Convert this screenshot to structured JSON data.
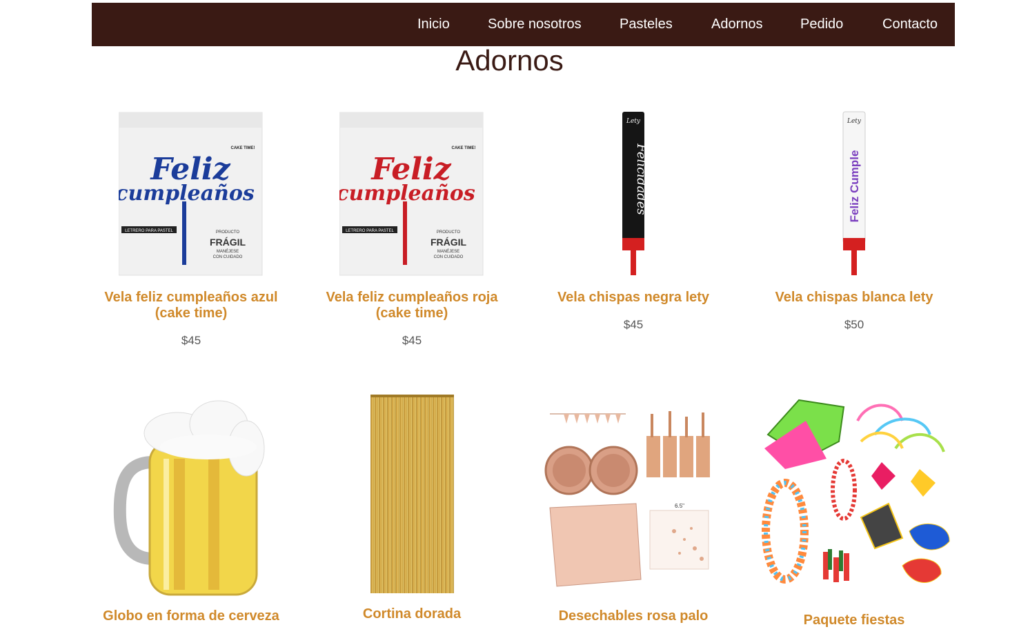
{
  "nav": {
    "items": [
      "Inicio",
      "Sobre nosotros",
      "Pasteles",
      "Adornos",
      "Pedido",
      "Contacto"
    ]
  },
  "page": {
    "title": "Adornos"
  },
  "products": [
    {
      "name": "Vela feliz cumpleaños azul (cake time)",
      "price": "$45",
      "image": "feliz-cumpleanos-topper-blue"
    },
    {
      "name": "Vela feliz cumpleaños roja (cake time)",
      "price": "$45",
      "image": "feliz-cumpleanos-topper-red"
    },
    {
      "name": "Vela chispas negra lety",
      "price": "$45",
      "image": "sparkler-candle-black"
    },
    {
      "name": "Vela chispas blanca lety",
      "price": "$50",
      "image": "sparkler-candle-white"
    },
    {
      "name": "Globo en forma de cerveza",
      "price": "",
      "image": "beer-mug-balloon"
    },
    {
      "name": "Cortina dorada",
      "price": "",
      "image": "gold-tinsel-curtain"
    },
    {
      "name": "Desechables rosa palo",
      "price": "",
      "image": "rose-gold-tableware-set"
    },
    {
      "name": "Paquete fiestas",
      "price": "",
      "image": "party-pack"
    }
  ],
  "image_text": {
    "topper_word1": "Feliz",
    "topper_word2": "cumpleaños",
    "package_label": "LETRERO PARA PASTEL",
    "package_brand": "CAKE TIME!",
    "package_fragile_1": "PRODUCTO",
    "package_fragile_2": "FRÁGIL",
    "package_fragile_3": "MANÉJESE",
    "package_fragile_4": "CON CUIDADO",
    "candle_brand": "Lety",
    "candle_black_text": "Felicidades",
    "candle_white_text": "Feliz Cumple",
    "napkin_size": "6.5\""
  },
  "colors": {
    "nav_bg": "#3a1a14",
    "nav_text": "#ffffff",
    "title": "#3a1a14",
    "product_name": "#d0892a",
    "price": "#555555"
  }
}
